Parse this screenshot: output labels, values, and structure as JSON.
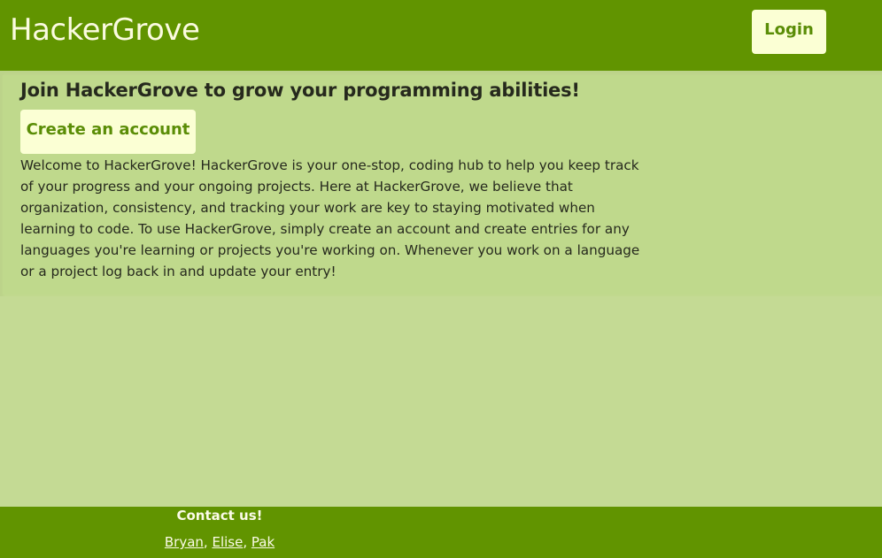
{
  "header": {
    "brand": "HackerGrove",
    "login_label": "Login"
  },
  "hero": {
    "title": "Join HackerGrove to grow your programming abilities!",
    "create_account_label": "Create an account",
    "intro": "Welcome to HackerGrove! HackerGrove is your one-stop, coding hub to help you keep track of your progress and your ongoing projects. Here at HackerGrove, we believe that organization, consistency, and tracking your work are key to staying motivated when learning to code. To use HackerGrove, simply create an account and create entries for any languages you're learning or projects you're working on. Whenever you work on a language or a project log back in and update your entry!"
  },
  "footer": {
    "title": "Contact us!",
    "links": [
      "Bryan",
      "Elise",
      "Pak"
    ],
    "separator": ", "
  },
  "colors": {
    "nav_bg": "#619400",
    "page_bg": "#c4da94",
    "button_bg": "#fbffd4",
    "button_text": "#5a8d06"
  }
}
